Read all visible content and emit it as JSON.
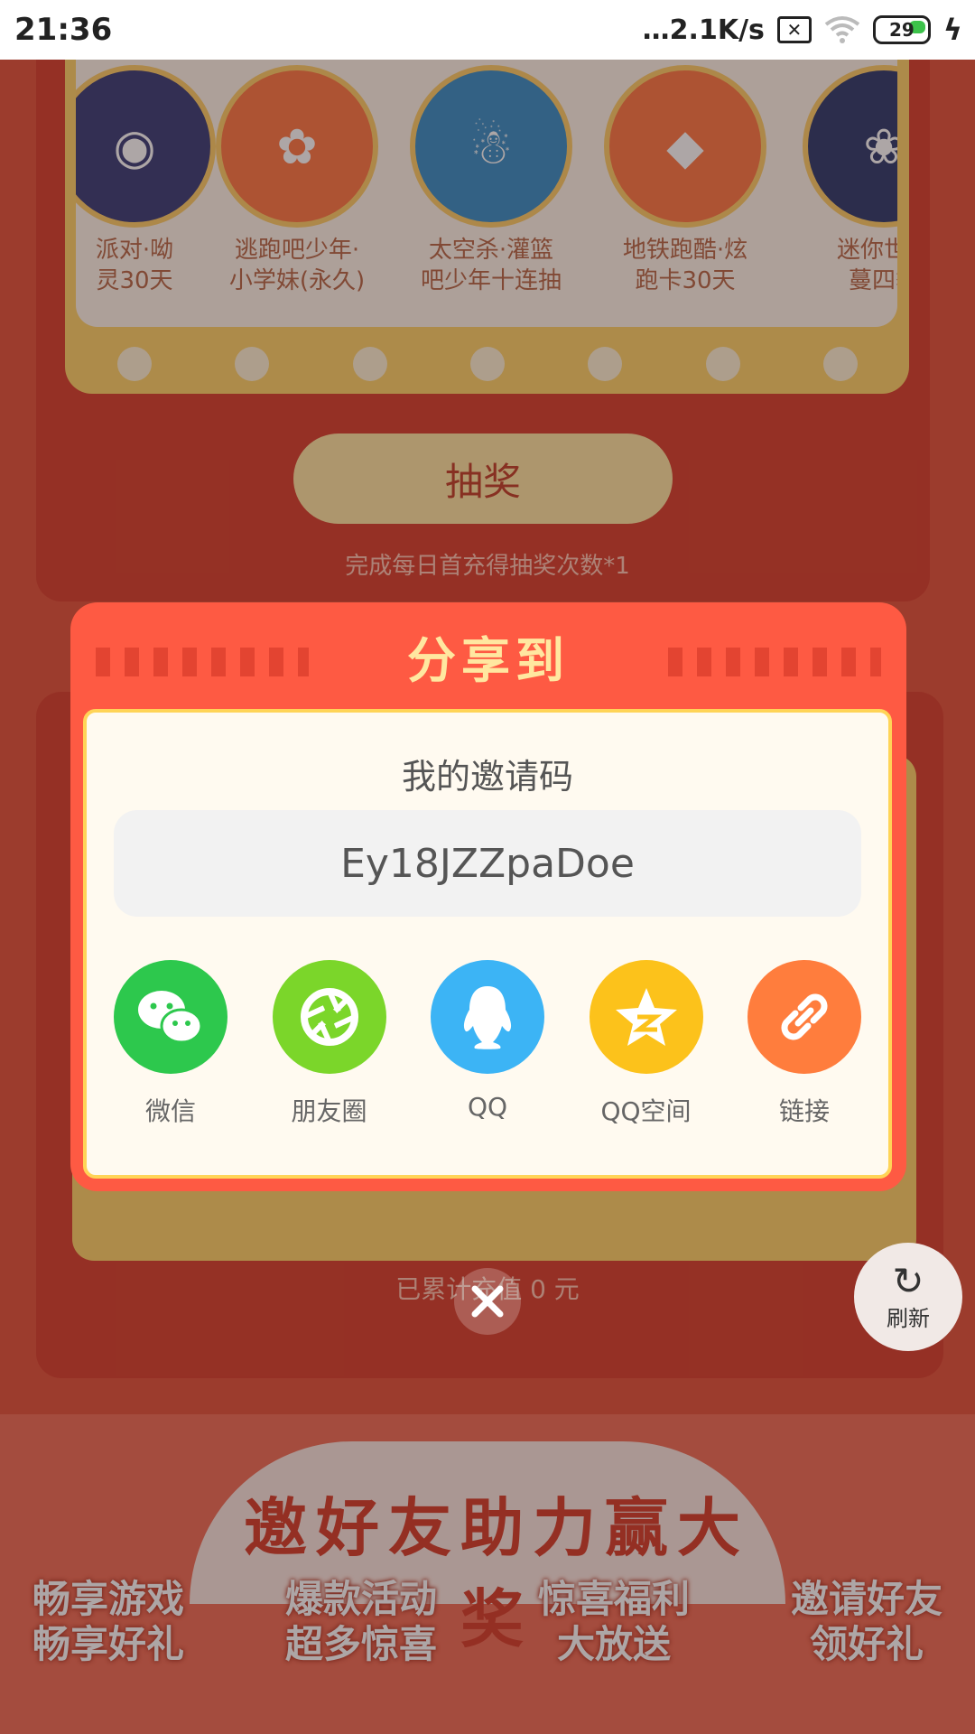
{
  "status_bar": {
    "time": "21:36",
    "network_speed": "…2.1K/s",
    "battery_level": "29"
  },
  "prizes": [
    {
      "label_line1": "派对·呦",
      "label_line2": "灵30天",
      "icon": "helicopter"
    },
    {
      "label_line1": "逃跑吧少年·",
      "label_line2": "小学妹(永久)",
      "icon": "anime-girl"
    },
    {
      "label_line1": "太空杀·灌篮",
      "label_line2": "吧少年十连抽",
      "icon": "astronaut"
    },
    {
      "label_line1": "地铁跑酷·炫",
      "label_line2": "跑卡30天",
      "icon": "badge"
    },
    {
      "label_line1": "迷你世界",
      "label_line2": "蔓四季",
      "icon": "doll"
    }
  ],
  "draw": {
    "button_label": "抽奖",
    "hint": "完成每日首充得抽奖次数*1"
  },
  "accumulated_text": "已累计充值 0 元",
  "refresh_label": "刷新",
  "banner": {
    "title": "邀好友助力赢大奖",
    "promos": [
      {
        "line1": "畅享游戏",
        "line2": "畅享好礼"
      },
      {
        "line1": "爆款活动",
        "line2": "超多惊喜"
      },
      {
        "line1": "惊喜福利",
        "line2": "大放送"
      },
      {
        "line1": "邀请好友",
        "line2": "领好礼"
      }
    ]
  },
  "dialog": {
    "title": "分享到",
    "code_label": "我的邀请码",
    "invite_code": "Ey18JZZpaDoe",
    "share_targets": [
      {
        "label": "微信",
        "icon": "wechat-icon",
        "color": "#2dc84d"
      },
      {
        "label": "朋友圈",
        "icon": "moments-icon",
        "color": "#7bd62a"
      },
      {
        "label": "QQ",
        "icon": "qq-icon",
        "color": "#3cb4f5"
      },
      {
        "label": "QQ空间",
        "icon": "qzone-icon",
        "color": "#fcc21b"
      },
      {
        "label": "链接",
        "icon": "link-icon",
        "color": "#ff7d3d"
      }
    ]
  },
  "colors": {
    "dialog_bg": "#fe5a43",
    "dialog_title": "#ffe7a0",
    "dialog_border": "#ffd457"
  }
}
